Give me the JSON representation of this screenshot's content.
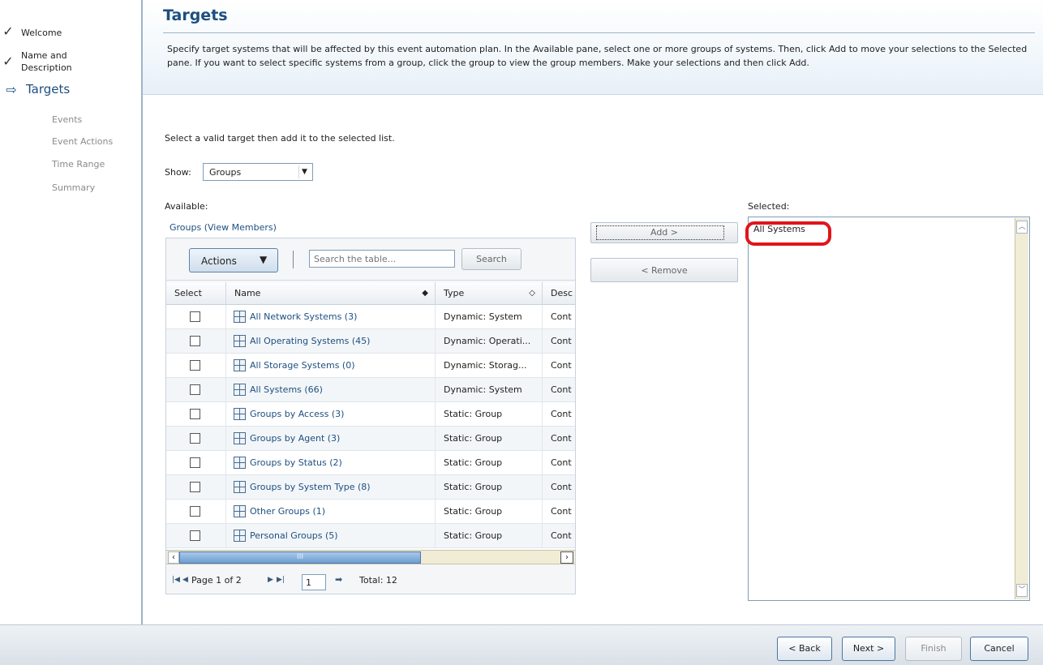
{
  "nav": {
    "items": [
      {
        "label": "Welcome",
        "state": "done"
      },
      {
        "label": "Name and\nDescription",
        "state": "done"
      },
      {
        "label": "Targets",
        "state": "current"
      },
      {
        "label": "Events",
        "state": "pending"
      },
      {
        "label": "Event Actions",
        "state": "pending"
      },
      {
        "label": "Time Range",
        "state": "pending"
      },
      {
        "label": "Summary",
        "state": "pending"
      }
    ]
  },
  "header": {
    "title": "Targets",
    "description": "Specify target systems that will be affected by this event automation plan. In the Available pane, select one or more groups of systems. Then, click Add to move your selections to the Selected pane. If you want to select specific systems from a group, click the group to view the group members. Make your selections and then click Add."
  },
  "main": {
    "instruction": "Select a valid target then add it to the selected list.",
    "show_label": "Show:",
    "show_value": "Groups",
    "available_label": "Available:",
    "groups_link": "Groups (View Members)",
    "actions_label": "Actions",
    "search_placeholder": "Search the table...",
    "search_button": "Search",
    "columns": [
      "Select",
      "Name",
      "Type",
      "Desc"
    ],
    "rows": [
      {
        "name": "All Network Systems (3)",
        "type": "Dynamic: System",
        "desc": "Cont"
      },
      {
        "name": "All Operating Systems (45)",
        "type": "Dynamic: Operati...",
        "desc": "Cont"
      },
      {
        "name": "All Storage Systems (0)",
        "type": "Dynamic: Storag...",
        "desc": "Cont"
      },
      {
        "name": "All Systems (66)",
        "type": "Dynamic: System",
        "desc": "Cont"
      },
      {
        "name": "Groups by Access (3)",
        "type": "Static: Group",
        "desc": "Cont"
      },
      {
        "name": "Groups by Agent (3)",
        "type": "Static: Group",
        "desc": "Cont"
      },
      {
        "name": "Groups by Status (2)",
        "type": "Static: Group",
        "desc": "Cont"
      },
      {
        "name": "Groups by System Type (8)",
        "type": "Static: Group",
        "desc": "Cont"
      },
      {
        "name": "Other Groups (1)",
        "type": "Static: Group",
        "desc": "Cont"
      },
      {
        "name": "Personal Groups (5)",
        "type": "Static: Group",
        "desc": "Cont"
      }
    ],
    "scroll_grip": "III",
    "pager_text": "Page 1 of 2",
    "pager_input": "1",
    "total": "Total: 12",
    "add_button": "Add >",
    "remove_button": "< Remove",
    "selected_label": "Selected:",
    "selected_items": [
      "All Systems"
    ]
  },
  "footer": {
    "back": "< Back",
    "next": "Next >",
    "finish": "Finish",
    "cancel": "Cancel"
  },
  "colors": {
    "accent": "#1d4f80",
    "highlight": "#e0141c"
  }
}
